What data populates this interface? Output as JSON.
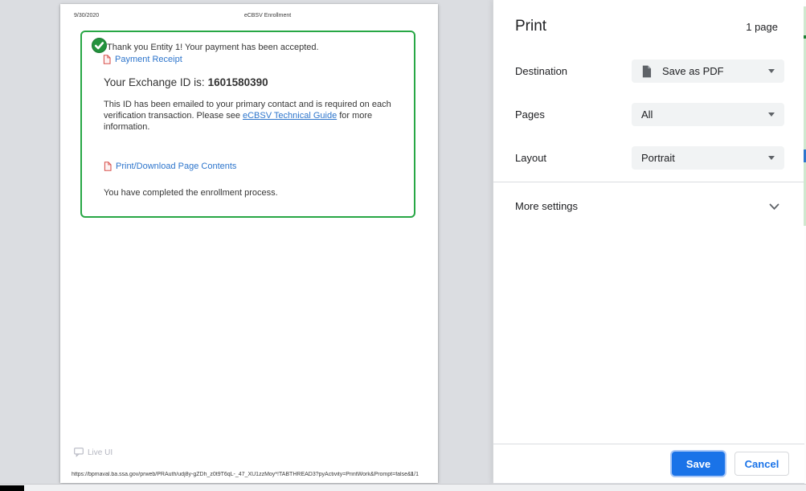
{
  "preview": {
    "header": {
      "date": "9/30/2020",
      "title": "eCBSV Enrollment"
    },
    "confirmation": {
      "message": "Thank you Entity 1! Your payment has been accepted.",
      "payment_receipt": "Payment Receipt",
      "exchange_id_label": "Your Exchange ID is:",
      "exchange_id": "1601580390",
      "info_text": "This ID has been emailed to your primary contact and is required on each verification transaction. Please see",
      "info_link": "eCBSV Technical Guide",
      "info_suffix": "for more information.",
      "print_download": "Print/Download Page Contents",
      "completed": "You have completed the enrollment process."
    },
    "live_ui": "Live UI",
    "footer": {
      "url": "https://bpmaval.ba.ssa.gov/prweb/PRAuth/udj8y-gZDh_z0t9T6qL-_47_XU1zzMoy*!TABTHREAD3?pyActivity=PrintWork&Prompt=false&PrintHarness...",
      "page_indicator": "1/1"
    }
  },
  "dialog": {
    "title": "Print",
    "page_count": "1 page",
    "fields": [
      {
        "label": "Destination",
        "value": "Save as PDF",
        "icon": "pdf-destination-icon"
      },
      {
        "label": "Pages",
        "value": "All"
      },
      {
        "label": "Layout",
        "value": "Portrait"
      }
    ],
    "more_settings": "More settings",
    "buttons": {
      "save": "Save",
      "cancel": "Cancel"
    }
  },
  "colors": {
    "accent_blue": "#1a73e8",
    "link_blue": "#2d75cc",
    "success_green": "#28a745",
    "pdf_red": "#d9534f",
    "preview_bg": "#dbdde1"
  }
}
